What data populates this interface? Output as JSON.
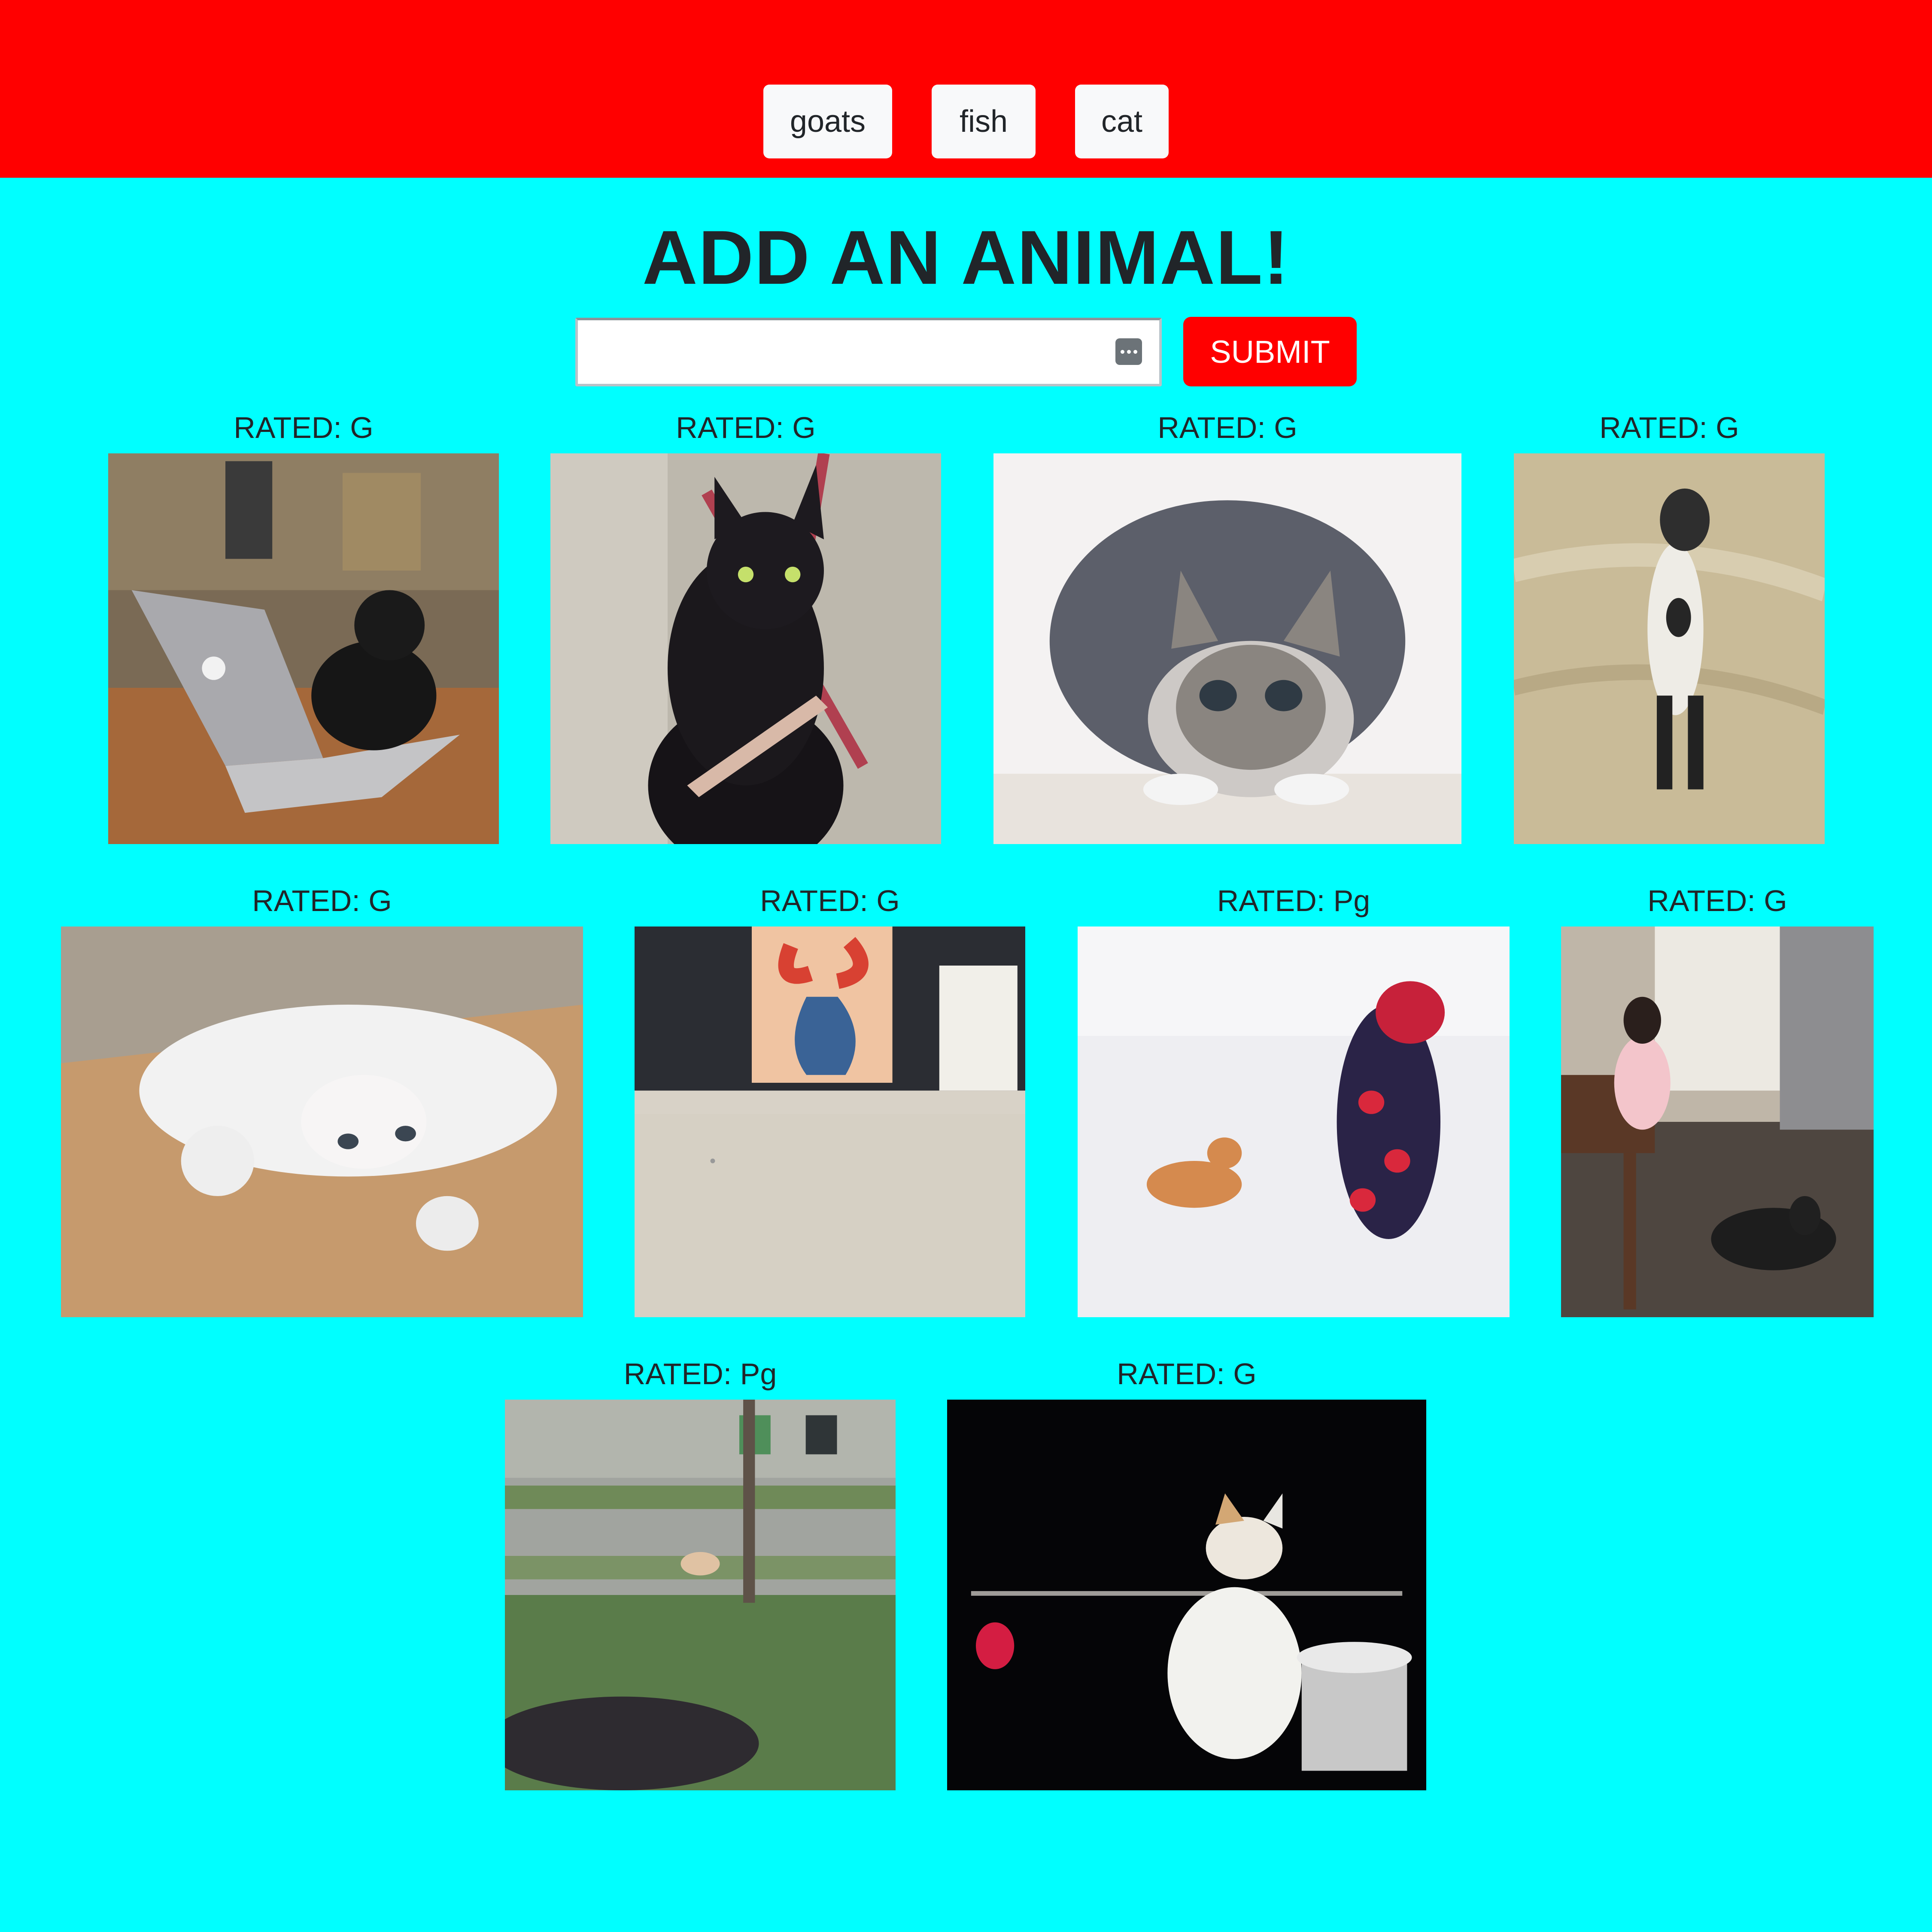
{
  "topics": [
    "goats",
    "fish",
    "cat"
  ],
  "heading": "ADD AN ANIMAL!",
  "form": {
    "input_value": "",
    "submit_label": "SUBMIT"
  },
  "gifs": [
    {
      "rating_label": "RATED: G",
      "depicts": "black cat typing on a laptop"
    },
    {
      "rating_label": "RATED: G",
      "depicts": "black cat filing its nails"
    },
    {
      "rating_label": "RATED: G",
      "depicts": "tabby cat crouching toward camera"
    },
    {
      "rating_label": "RATED: G",
      "depicts": "cat standing upright on a beach"
    },
    {
      "rating_label": "RATED: G",
      "depicts": "white kitten lying upside down"
    },
    {
      "rating_label": "RATED: G",
      "depicts": "room with vase painting and ESPN magazine"
    },
    {
      "rating_label": "RATED: Pg",
      "depicts": "cat and child in red snowsuit in snow"
    },
    {
      "rating_label": "RATED: G",
      "depicts": "toddler and black-and-white cat in kitchen"
    },
    {
      "rating_label": "RATED: Pg",
      "depicts": "cat leaping on a lawn near trash bins"
    },
    {
      "rating_label": "RATED: G",
      "depicts": "white cat next to a bucket on black background"
    }
  ],
  "colors": {
    "topbar": "#ff0000",
    "page_background": "#00ffff",
    "submit_button": "#ff0000",
    "topic_button": "#f8f9fa"
  }
}
